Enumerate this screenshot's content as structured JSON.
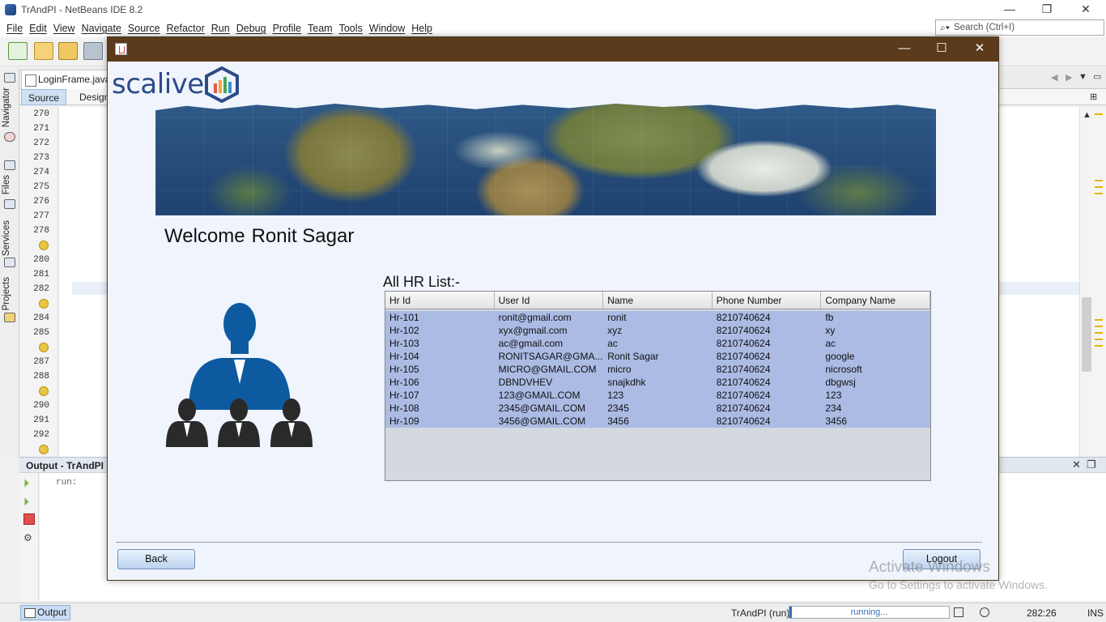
{
  "ide": {
    "title": "TrAndPI - NetBeans IDE 8.2",
    "window_controls": [
      "—",
      "❐",
      "✕"
    ],
    "menu": [
      "File",
      "Edit",
      "View",
      "Navigate",
      "Source",
      "Refactor",
      "Run",
      "Debug",
      "Profile",
      "Team",
      "Tools",
      "Window",
      "Help"
    ],
    "search_placeholder": "Search (Ctrl+I)",
    "side_tabs": [
      "Navigator",
      "Files",
      "Services",
      "Projects"
    ],
    "file_tab": "LoginFrame.java",
    "editor_tabs": [
      "Source",
      "Design"
    ],
    "line_numbers": [
      "270",
      "271",
      "272",
      "273",
      "274",
      "275",
      "276",
      "277",
      "278",
      "",
      "280",
      "281",
      "282",
      "",
      "284",
      "285",
      "",
      "287",
      "288",
      "",
      "290",
      "291",
      "292",
      ""
    ],
    "output_title": "Output - TrAndPI (",
    "output_text": "run:",
    "status": {
      "output_button": "Output",
      "project": "TrAndPI (run)",
      "progress_text": "running...",
      "position": "282:26",
      "mode": "INS"
    },
    "watermark": {
      "line1": "Activate Windows",
      "line2": "Go to Settings to activate Windows."
    }
  },
  "app": {
    "logo_text": "scalive",
    "welcome_prefix": "Welcome",
    "user_name": "Ronit Sagar",
    "list_label": "All HR List:-",
    "window_controls": [
      "—",
      "☐",
      "✕"
    ],
    "table": {
      "columns": [
        "Hr Id",
        "User Id",
        "Name",
        "Phone Number",
        "Company Name"
      ],
      "rows": [
        [
          "Hr-101",
          "ronit@gmail.com",
          "ronit",
          "8210740624",
          "fb"
        ],
        [
          "Hr-102",
          "xyx@gmail.com",
          "xyz",
          "8210740624",
          "xy"
        ],
        [
          "Hr-103",
          "ac@gmail.com",
          "ac",
          "8210740624",
          "ac"
        ],
        [
          "Hr-104",
          "RONITSAGAR@GMA...",
          "Ronit Sagar",
          "8210740624",
          "google"
        ],
        [
          "Hr-105",
          "MICRO@GMAIL.COM",
          "micro",
          "8210740624",
          "nicrosoft"
        ],
        [
          "Hr-106",
          "DBNDVHEV",
          "snajkdhk",
          "8210740624",
          "dbgwsj"
        ],
        [
          "Hr-107",
          "123@GMAIL.COM",
          "123",
          "8210740624",
          "123"
        ],
        [
          "Hr-108",
          "2345@GMAIL.COM",
          "2345",
          "8210740624",
          "234"
        ],
        [
          "Hr-109",
          "3456@GMAIL.COM",
          "3456",
          "8210740624",
          "3456"
        ]
      ]
    },
    "back_label": "Back",
    "logout_label": "Logout",
    "colors": {
      "titlebar": "#5b3b1b",
      "row_selected": "#abbbe4",
      "people_icon": "#0d5aa0"
    }
  }
}
